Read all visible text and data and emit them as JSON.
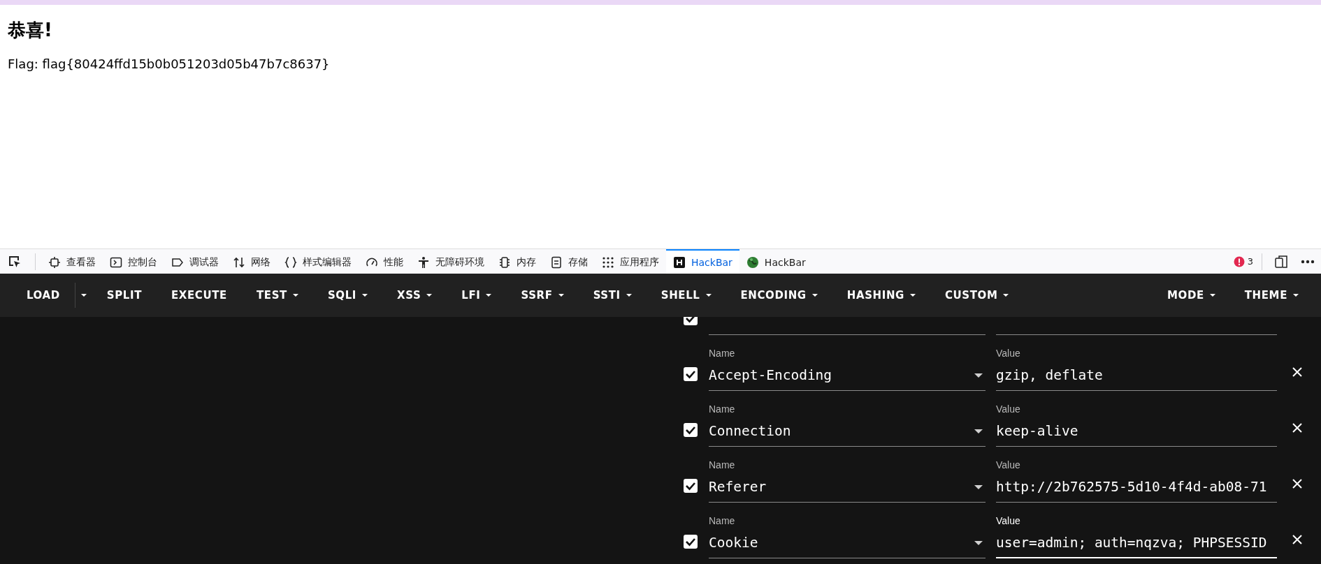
{
  "page": {
    "heading": "恭喜!",
    "flag_text": "Flag: flag{80424ffd15b0b051203d05b47b7c8637}"
  },
  "devtools": {
    "tabs": [
      {
        "kind": "inspector",
        "label": "查看器",
        "selected": false
      },
      {
        "kind": "console",
        "label": "控制台",
        "selected": false
      },
      {
        "kind": "debugger",
        "label": "调试器",
        "selected": false
      },
      {
        "kind": "network",
        "label": "网络",
        "selected": false
      },
      {
        "kind": "style",
        "label": "样式编辑器",
        "selected": false
      },
      {
        "kind": "performance",
        "label": "性能",
        "selected": false
      },
      {
        "kind": "accessibility",
        "label": "无障碍环境",
        "selected": false
      },
      {
        "kind": "memory",
        "label": "内存",
        "selected": false
      },
      {
        "kind": "storage",
        "label": "存储",
        "selected": false
      },
      {
        "kind": "application",
        "label": "应用程序",
        "selected": false
      },
      {
        "kind": "hackbar-h",
        "label": "HackBar",
        "selected": true
      },
      {
        "kind": "hackbar-globe",
        "label": "HackBar",
        "selected": false
      }
    ],
    "error_count": "3"
  },
  "hackbar": {
    "menu": [
      {
        "label": "LOAD",
        "kind": "split"
      },
      {
        "label": "SPLIT",
        "kind": "button"
      },
      {
        "label": "EXECUTE",
        "kind": "button"
      },
      {
        "label": "TEST",
        "kind": "dropdown"
      },
      {
        "label": "SQLI",
        "kind": "dropdown"
      },
      {
        "label": "XSS",
        "kind": "dropdown"
      },
      {
        "label": "LFI",
        "kind": "dropdown"
      },
      {
        "label": "SSRF",
        "kind": "dropdown"
      },
      {
        "label": "SSTI",
        "kind": "dropdown"
      },
      {
        "label": "SHELL",
        "kind": "dropdown"
      },
      {
        "label": "ENCODING",
        "kind": "dropdown"
      },
      {
        "label": "HASHING",
        "kind": "dropdown"
      },
      {
        "label": "CUSTOM",
        "kind": "dropdown"
      }
    ],
    "right_menu": [
      {
        "label": "MODE",
        "kind": "dropdown"
      },
      {
        "label": "THEME",
        "kind": "dropdown"
      }
    ],
    "headers": [
      {
        "checked": true,
        "focused": false
      },
      {
        "name_label": "Name",
        "value_label": "Value",
        "name": "Accept-Encoding",
        "value": "gzip, deflate",
        "checked": true,
        "focused": false
      },
      {
        "name_label": "Name",
        "value_label": "Value",
        "name": "Connection",
        "value": "keep-alive",
        "checked": true,
        "focused": false
      },
      {
        "name_label": "Name",
        "value_label": "Value",
        "name": "Referer",
        "value": "http://2b762575-5d10-4f4d-ab08-71",
        "checked": true,
        "focused": false
      },
      {
        "name_label": "Name",
        "value_label": "Value",
        "name": "Cookie",
        "value": "user=admin; auth=nqzva; PHPSESSID",
        "checked": true,
        "focused": true
      }
    ]
  }
}
